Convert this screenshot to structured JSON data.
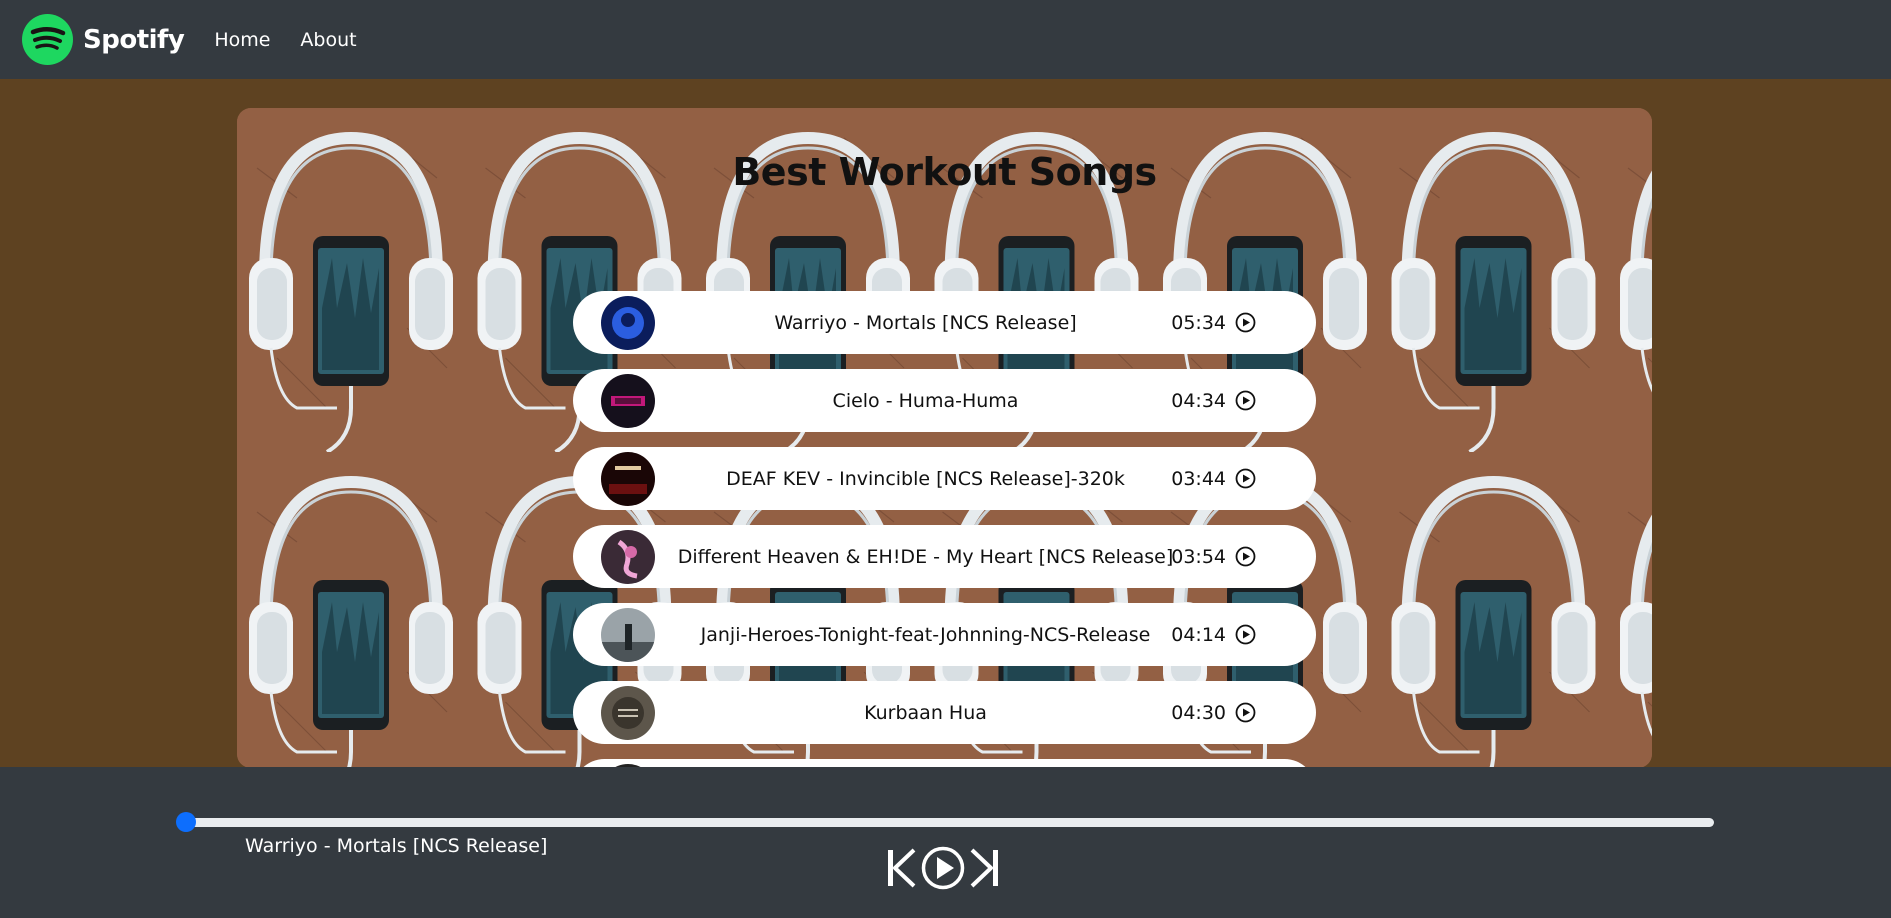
{
  "nav": {
    "brand": "Spotify",
    "links": [
      "Home",
      "About"
    ]
  },
  "main": {
    "title": "Best Workout Songs",
    "songs": [
      {
        "name": "Warriyo - Mortals [NCS Release]",
        "duration": "05:34",
        "cover_color": "#1a3fa8"
      },
      {
        "name": "Cielo - Huma-Huma",
        "duration": "04:34",
        "cover_color": "#24142e"
      },
      {
        "name": "DEAF KEV - Invincible [NCS Release]-320k",
        "duration": "03:44",
        "cover_color": "#3a0a0a"
      },
      {
        "name": "Different Heaven & EH!DE - My Heart [NCS Release]",
        "duration": "03:54",
        "cover_color": "#5a2e4a"
      },
      {
        "name": "Janji-Heroes-Tonight-feat-Johnning-NCS-Release",
        "duration": "04:14",
        "cover_color": "#4a5256"
      },
      {
        "name": "Kurbaan Hua",
        "duration": "04:30",
        "cover_color": "#4a4438"
      }
    ]
  },
  "player": {
    "now_playing": "Warriyo - Mortals [NCS Release]",
    "progress": 0,
    "accent": "#0d6efd"
  },
  "icons": {
    "play_circle": "play-circle-icon",
    "previous": "skip-back-icon",
    "next": "skip-forward-icon"
  }
}
